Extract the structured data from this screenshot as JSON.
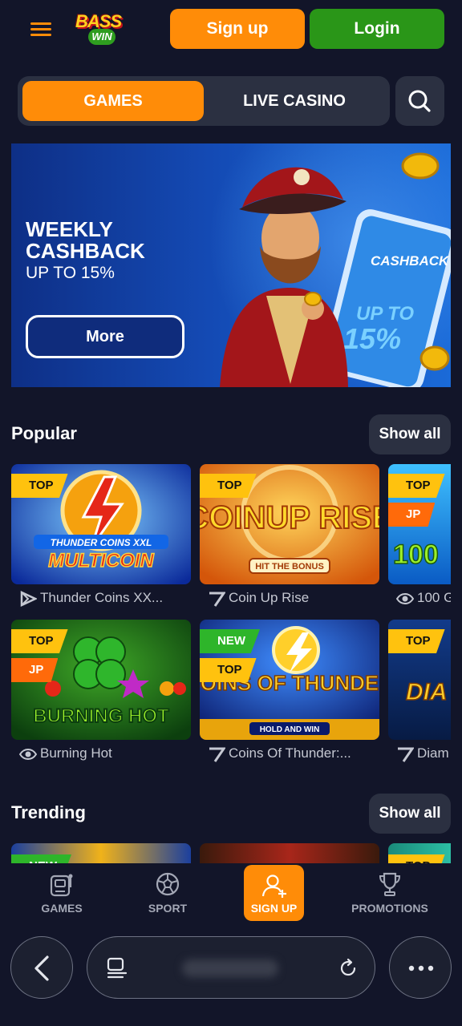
{
  "header": {
    "logo_text_top": "BASS",
    "logo_text_bottom": "WIN",
    "signup_label": "Sign up",
    "login_label": "Login"
  },
  "tabs": [
    {
      "label": "GAMES",
      "active": true
    },
    {
      "label": "LIVE CASINO",
      "active": false
    }
  ],
  "banner": {
    "title": "WEEKLY CASHBACK",
    "subtitle": "UP TO 15%",
    "button_label": "More",
    "phone_text_1": "CASHBACK",
    "phone_text_2": "UP TO",
    "phone_text_3": "15%"
  },
  "popular": {
    "title": "Popular",
    "show_all_label": "Show all",
    "rows": [
      [
        {
          "name": "Thunder Coins XX...",
          "art_text": "MULTICOIN",
          "art_text2": "THUNDER COINS XXL",
          "badges": [
            "TOP"
          ],
          "provider_icon": "play-provider-icon"
        },
        {
          "name": "Coin Up Rise",
          "art_text": "COINUP RISE",
          "art_text2": "HIT THE BONUS",
          "badges": [
            "TOP"
          ],
          "provider_icon": "seven-provider-icon"
        },
        {
          "name": "100 G",
          "art_text": "100",
          "badges": [
            "TOP",
            "JP"
          ],
          "provider_icon": "eye-provider-icon"
        }
      ],
      [
        {
          "name": "Burning Hot",
          "art_text": "BURNING HOT",
          "badges": [
            "TOP",
            "JP"
          ],
          "provider_icon": "eye-provider-icon"
        },
        {
          "name": "Coins Of Thunder:...",
          "art_text": "COINS OF THUNDER",
          "art_text2": "HOLD AND WIN",
          "badges": [
            "NEW",
            "TOP"
          ],
          "provider_icon": "seven-provider-icon"
        },
        {
          "name": "Diam",
          "art_text": "DIA ST",
          "badges": [
            "TOP"
          ],
          "provider_icon": "seven-provider-icon"
        }
      ]
    ]
  },
  "trending": {
    "title": "Trending",
    "show_all_label": "Show all",
    "badges": [
      "NEW",
      "TOP"
    ]
  },
  "bottom_nav": [
    {
      "label": "GAMES",
      "icon": "slot-machine-icon",
      "active": false
    },
    {
      "label": "SPORT",
      "icon": "soccer-ball-icon",
      "active": false
    },
    {
      "label": "SIGN UP",
      "icon": "add-user-icon",
      "active": true
    },
    {
      "label": "PROMOTIONS",
      "icon": "trophy-icon",
      "active": false
    }
  ],
  "colors": {
    "background": "#121529",
    "accent_orange": "#ff8c08",
    "accent_green": "#2a9618",
    "panel": "#2b3041",
    "badge_top": "#ffc20e",
    "badge_jp": "#ff6a0a",
    "badge_new": "#2eb52a"
  }
}
